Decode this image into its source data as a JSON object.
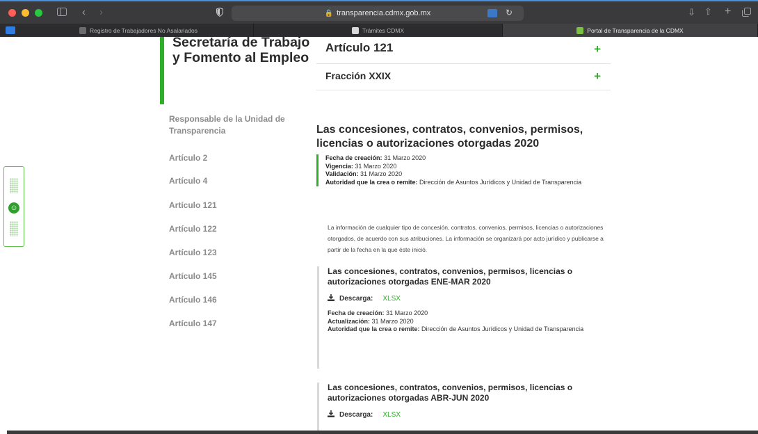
{
  "browser": {
    "url": "transparencia.cdmx.gob.mx",
    "tabs": [
      {
        "label": "Registro de Trabajadores No Asalariados",
        "active": false
      },
      {
        "label": "Trámites CDMX",
        "active": false
      },
      {
        "label": "Portal de Transparencia de la CDMX",
        "active": true
      }
    ],
    "icons": {
      "sidebar": "sidebar-icon",
      "back": "chevron-left-icon",
      "forward": "chevron-right-icon",
      "shield": "shield-icon",
      "download": "download-icon",
      "share": "share-icon",
      "new_tab": "plus-icon",
      "tabs_overview": "tabs-icon"
    }
  },
  "colors": {
    "accent": "#2fae28",
    "toolbar": "#3a3a3c",
    "tabbar": "#2c2c2e"
  },
  "sidebar": {
    "title": "Secretaría de Trabajo y Fomento al Empleo",
    "items": [
      "Responsable de la Unidad de Transparencia",
      "Artículo 2",
      "Artículo 4",
      "Artículo 121",
      "Artículo 122",
      "Artículo 123",
      "Artículo 145",
      "Artículo 146",
      "Artículo 147"
    ]
  },
  "accordion": {
    "article": {
      "label": "Artículo 121",
      "toggle": "+"
    },
    "fraction": {
      "label": "Fracción XXIX",
      "toggle": "+"
    }
  },
  "content": {
    "title": "Las concesiones, contratos, convenios, permisos, licencias o autorizaciones otorgadas 2020",
    "meta": {
      "creation_label": "Fecha de creación:",
      "creation_value": "31 Marzo 2020",
      "validity_label": "Vigencia:",
      "validity_value": "31 Marzo 2020",
      "validation_label": "Validación:",
      "validation_value": "31 Marzo 2020",
      "authority_label": "Autoridad que la crea o remite:",
      "authority_value": "Dirección de Asuntos Jurídicos y Unidad de Transparencia"
    },
    "description": "La información de cualquier tipo de concesión, contratos, convenios, permisos, licencias o autorizaciones otorgados, de acuerdo con sus atribuciones. La información se organizará por acto jurídico y publicarse a partir de la fecha en la que éste inició.",
    "documents": [
      {
        "title": "Las concesiones, contratos, convenios, permisos, licencias o autorizaciones otorgadas ENE-MAR 2020",
        "download_label": "Descarga:",
        "format": "XLSX",
        "creation_label": "Fecha de creación:",
        "creation_value": "31 Marzo 2020",
        "update_label": "Actualización:",
        "update_value": "31 Marzo 2020",
        "authority_label": "Autoridad que la crea o remite:",
        "authority_value": "Dirección de Asuntos Jurídicos y Unidad de Transparencia"
      },
      {
        "title": "Las concesiones, contratos, convenios, permisos, licencias o autorizaciones otorgadas ABR-JUN 2020",
        "download_label": "Descarga:",
        "format": "XLSX"
      }
    ]
  }
}
